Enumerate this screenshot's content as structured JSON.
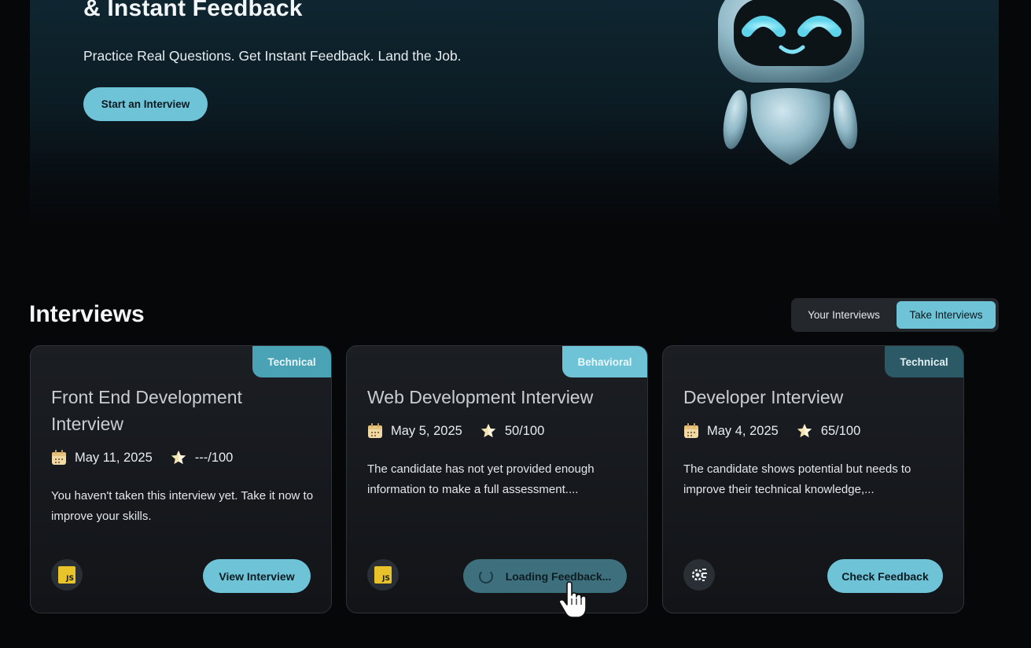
{
  "hero": {
    "title": "& Instant Feedback",
    "subtitle": "Practice Real Questions. Get Instant Feedback. Land the Job.",
    "cta_label": "Start an Interview"
  },
  "interviews": {
    "title": "Interviews",
    "toggle": {
      "your_label": "Your Interviews",
      "take_label": "Take Interviews",
      "active": "Take Interviews"
    },
    "cards": [
      {
        "badge": "Technical",
        "title": "Front End Development Interview",
        "date": "May 11, 2025",
        "score": "---/100",
        "description": "You haven't taken this interview yet. Take it now to improve your skills.",
        "tech_icon": "javascript-icon",
        "button_label": "View Interview"
      },
      {
        "badge": "Behavioral",
        "title": "Web Development Interview",
        "date": "May 5, 2025",
        "score": "50/100",
        "description": "The candidate has not yet provided enough information to make a full assessment....",
        "tech_icon": "javascript-icon",
        "button_label": "Loading Feedback..."
      },
      {
        "badge": "Technical",
        "title": "Developer Interview",
        "date": "May 4, 2025",
        "score": "65/100",
        "description": "The candidate shows potential but needs to improve their technical knowledge,...",
        "tech_icon": "gear-code-icon",
        "button_label": "Check Feedback"
      }
    ]
  },
  "colors": {
    "accent": "#6fc3d6",
    "background": "#060709",
    "card_bg": "#16191d"
  }
}
